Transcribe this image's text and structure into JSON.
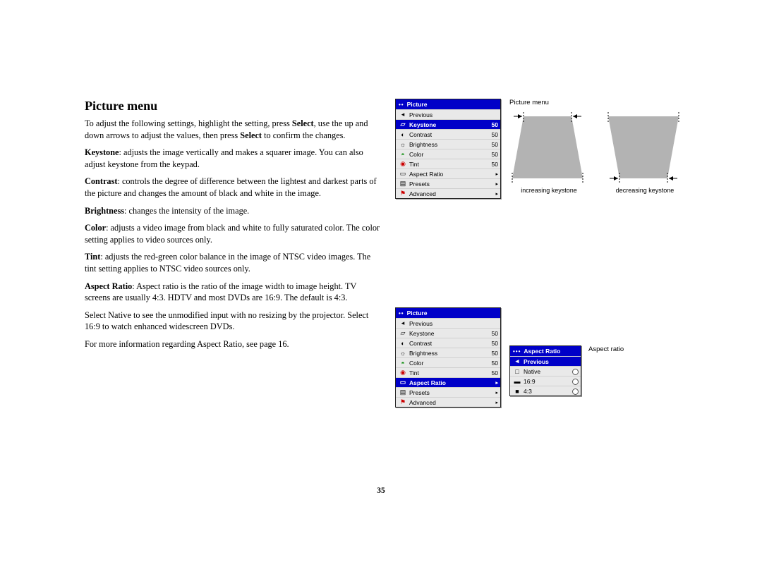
{
  "heading": "Picture menu",
  "intro_a": "To adjust the following settings, highlight the setting, press ",
  "intro_select1": "Select",
  "intro_b": ", use the up and down arrows to adjust the values, then press ",
  "intro_select2": "Select",
  "intro_c": " to confirm the changes.",
  "keystone_label": "Keystone",
  "keystone_text": ": adjusts the image vertically and makes a squarer image. You can also adjust keystone from the keypad.",
  "contrast_label": "Contrast",
  "contrast_text": ": controls the degree of difference between the lightest and darkest parts of the picture and changes the amount of black and white in the image.",
  "brightness_label": "Brightness",
  "brightness_text": ": changes the intensity of the image.",
  "color_label": "Color",
  "color_text": ": adjusts a video image from black and white to fully saturated color. The color setting applies to video sources only.",
  "tint_label": "Tint",
  "tint_text": ": adjusts the red-green color balance in the image of NTSC video images. The tint setting applies to NTSC video sources only.",
  "aspect_label": "Aspect Ratio",
  "aspect_text": ": Aspect ratio is the ratio of the image width to image height. TV screens are usually 4:3. HDTV and most DVDs are 16:9. The default is 4:3.",
  "aspect_p2": "Select Native to see the unmodified input with no resizing by the projector. Select 16:9 to watch enhanced widescreen DVDs.",
  "aspect_p3": "For more information regarding Aspect Ratio, see page 16.",
  "page_number": "35",
  "side": {
    "picture_menu_label": "Picture menu",
    "inc_keystone": "increasing keystone",
    "dec_keystone": "decreasing keystone",
    "aspect_ratio_label": "Aspect ratio"
  },
  "osd1": {
    "title": "Picture",
    "rows": {
      "previous": "Previous",
      "keystone": "Keystone",
      "keystone_v": "50",
      "contrast": "Contrast",
      "contrast_v": "50",
      "brightness": "Brightness",
      "brightness_v": "50",
      "color": "Color",
      "color_v": "50",
      "tint": "Tint",
      "tint_v": "50",
      "aspect": "Aspect Ratio",
      "presets": "Presets",
      "advanced": "Advanced"
    }
  },
  "osd2": {
    "title": "Picture",
    "rows": {
      "previous": "Previous",
      "keystone": "Keystone",
      "keystone_v": "50",
      "contrast": "Contrast",
      "contrast_v": "50",
      "brightness": "Brightness",
      "brightness_v": "50",
      "color": "Color",
      "color_v": "50",
      "tint": "Tint",
      "tint_v": "50",
      "aspect": "Aspect Ratio",
      "presets": "Presets",
      "advanced": "Advanced"
    }
  },
  "osd3": {
    "title": "Aspect Ratio",
    "rows": {
      "previous": "Previous",
      "native": "Native",
      "r169": "16:9",
      "r43": "4:3"
    }
  }
}
